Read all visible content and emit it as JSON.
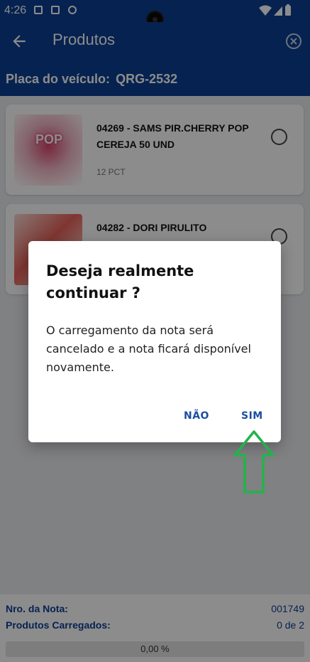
{
  "status_bar": {
    "time": "4:26"
  },
  "app_bar": {
    "title": "Produtos",
    "plate_label": "Placa do veículo:",
    "plate_value": "QRG-2532"
  },
  "products": [
    {
      "name": "04269 - SAMS PIR.CHERRY POP CEREJA 50 UND",
      "quantity": "12 PCT",
      "selected": false
    },
    {
      "name": "04282 - DORI PIRULITO",
      "quantity": "",
      "selected": false
    }
  ],
  "footer": {
    "invoice_label": "Nro. da Nota:",
    "invoice_value": "001749",
    "loaded_label": "Produtos Carregados:",
    "loaded_value": "0 de 2",
    "progress_text": "0,00 %",
    "progress_fraction": 0
  },
  "dialog": {
    "title": "Deseja realmente continuar ?",
    "message": "O carregamento da nota será cancelado e a nota ficará disponível novamente.",
    "no_label": "NÃO",
    "yes_label": "SIM"
  },
  "colors": {
    "primary": "#0b3f92",
    "accent_button": "#1a4fa0",
    "highlight_arrow": "#22b34a"
  },
  "icons": {
    "back": "arrow-left-icon",
    "close": "close-circle-icon",
    "arrow_pointer": "arrow-up-outline-icon"
  }
}
